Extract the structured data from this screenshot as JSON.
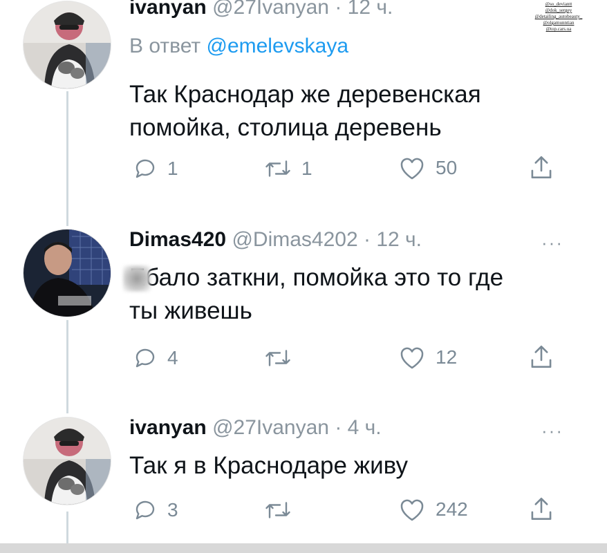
{
  "watermark": {
    "lines": [
      "@so_deviantt",
      "@dok_sergey",
      "@detailing_autobeauty_",
      "@olgamunntian",
      "@top.cars.ua"
    ]
  },
  "tweets": [
    {
      "name": "ivanyan",
      "handle": "@27Ivanyan",
      "time": "· 12 ч.",
      "reply_prefix": "В ответ",
      "reply_mention": "@emelevskaya",
      "text_line1": "Так Краснодар же деревенская",
      "text_line2": "помойка, столица деревень",
      "replies": "1",
      "retweets": "1",
      "likes": "50"
    },
    {
      "name": "Dimas420",
      "handle": "@Dimas4202",
      "time": "· 12 ч.",
      "more": "···",
      "text_line1": "Ебало заткни, помойка это то где",
      "text_line2": "ты живешь",
      "replies": "4",
      "retweets": "",
      "likes": "12"
    },
    {
      "name": "ivanyan",
      "handle": "@27Ivanyan",
      "time": "· 4 ч.",
      "more": "···",
      "text_line1": "Так я в Краснодаре живу",
      "replies": "3",
      "retweets": "",
      "likes": "242"
    }
  ],
  "colors": {
    "link": "#1d9bf0",
    "muted": "#8a959e",
    "text": "#0f1419"
  },
  "icons": [
    "reply-icon",
    "retweet-icon",
    "like-icon",
    "share-icon"
  ]
}
